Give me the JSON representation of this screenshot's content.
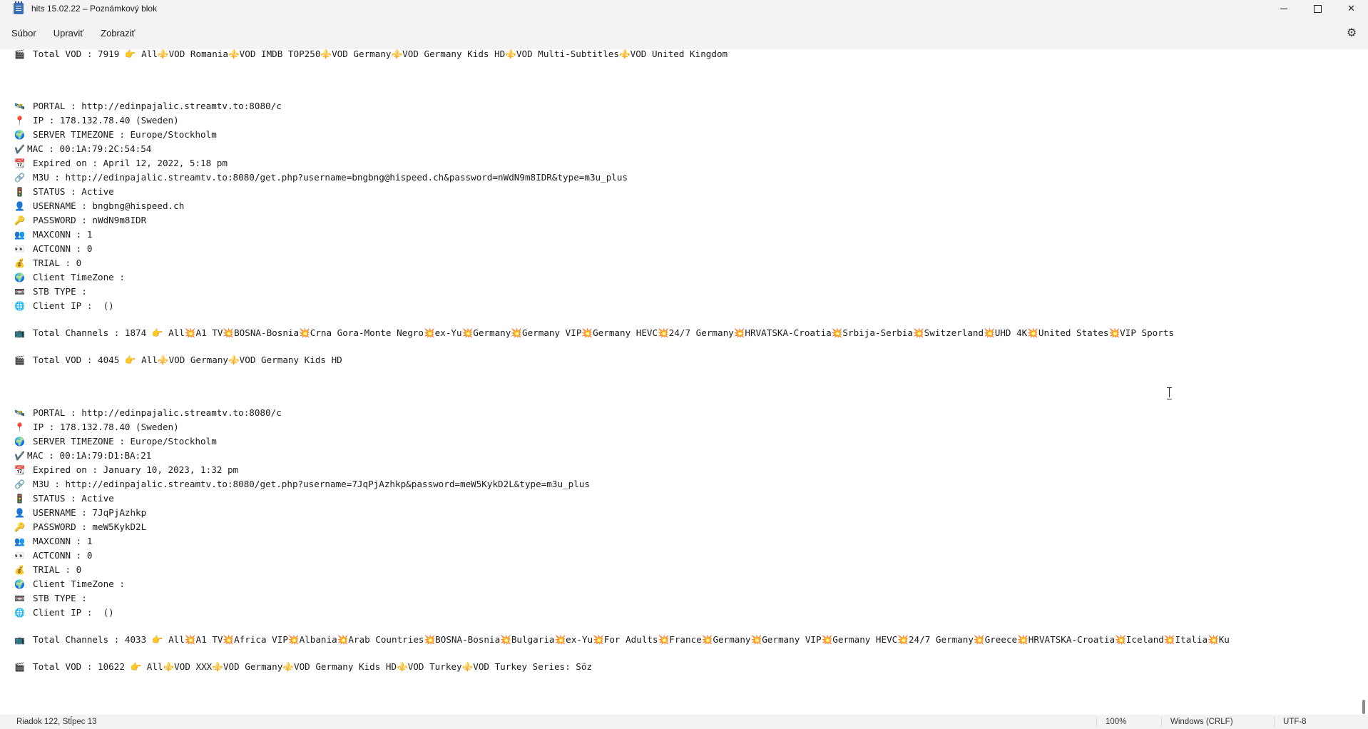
{
  "window": {
    "title": "hits 15.02.22 – Poznámkový blok"
  },
  "menu": {
    "file": "Súbor",
    "edit": "Upraviť",
    "view": "Zobraziť"
  },
  "lines": [
    {
      "emoji": "🎬",
      "text": "Total VOD : 7919 👉 All⚜️VOD Romania⚜️VOD IMDB TOP250⚜️VOD Germany⚜️VOD Germany Kids HD⚜️VOD Multi-Subtitles⚜️VOD United Kingdom"
    },
    {
      "emoji": "🛰️",
      "text": "PORTAL : http://edinpajalic.streamtv.to:8080/c"
    },
    {
      "emoji": "📍",
      "text": "IP : 178.132.78.40 (Sweden)"
    },
    {
      "emoji": "🌍",
      "text": "SERVER TIMEZONE : Europe/Stockholm"
    },
    {
      "emoji": "✔️",
      "text": "MAC : 00:1A:79:2C:54:54"
    },
    {
      "emoji": "📆",
      "text": "Expired on : April 12, 2022, 5:18 pm"
    },
    {
      "emoji": "🔗",
      "text": "M3U : http://edinpajalic.streamtv.to:8080/get.php?username=bngbng@hispeed.ch&password=nWdN9m8IDR&type=m3u_plus"
    },
    {
      "emoji": "🚦",
      "text": "STATUS : Active"
    },
    {
      "emoji": "👤",
      "text": "USERNAME : bngbng@hispeed.ch"
    },
    {
      "emoji": "🔑",
      "text": "PASSWORD : nWdN9m8IDR"
    },
    {
      "emoji": "👥",
      "text": "MAXCONN : 1"
    },
    {
      "emoji": "👀",
      "text": "ACTCONN : 0"
    },
    {
      "emoji": "💰",
      "text": "TRIAL : 0"
    },
    {
      "emoji": "🌍",
      "text": "Client TimeZone :"
    },
    {
      "emoji": "📼",
      "text": "STB TYPE :"
    },
    {
      "emoji": "🌐",
      "text": "Client IP :  ()"
    },
    {
      "emoji": "📺",
      "text": "Total Channels : 1874 👉 All💥A1 TV💥BOSNA-Bosnia💥Crna Gora-Monte Negro💥ex-Yu💥Germany💥Germany VIP💥Germany HEVC💥24/7 Germany💥HRVATSKA-Croatia💥Srbija-Serbia💥Switzerland💥UHD 4K💥United States💥VIP Sports"
    },
    {
      "emoji": "🎬",
      "text": "Total VOD : 4045 👉 All⚜️VOD Germany⚜️VOD Germany Kids HD"
    },
    {
      "emoji": "🛰️",
      "text": "PORTAL : http://edinpajalic.streamtv.to:8080/c"
    },
    {
      "emoji": "📍",
      "text": "IP : 178.132.78.40 (Sweden)"
    },
    {
      "emoji": "🌍",
      "text": "SERVER TIMEZONE : Europe/Stockholm"
    },
    {
      "emoji": "✔️",
      "text": "MAC : 00:1A:79:D1:BA:21"
    },
    {
      "emoji": "📆",
      "text": "Expired on : January 10, 2023, 1:32 pm"
    },
    {
      "emoji": "🔗",
      "text": "M3U : http://edinpajalic.streamtv.to:8080/get.php?username=7JqPjAzhkp&password=meW5KykD2L&type=m3u_plus"
    },
    {
      "emoji": "🚦",
      "text": "STATUS : Active"
    },
    {
      "emoji": "👤",
      "text": "USERNAME : 7JqPjAzhkp"
    },
    {
      "emoji": "🔑",
      "text": "PASSWORD : meW5KykD2L"
    },
    {
      "emoji": "👥",
      "text": "MAXCONN : 1"
    },
    {
      "emoji": "👀",
      "text": "ACTCONN : 0"
    },
    {
      "emoji": "💰",
      "text": "TRIAL : 0"
    },
    {
      "emoji": "🌍",
      "text": "Client TimeZone :"
    },
    {
      "emoji": "📼",
      "text": "STB TYPE :"
    },
    {
      "emoji": "🌐",
      "text": "Client IP :  ()"
    },
    {
      "emoji": "📺",
      "text": "Total Channels : 4033 👉 All💥A1 TV💥Africa VIP💥Albania💥Arab Countries💥BOSNA-Bosnia💥Bulgaria💥ex-Yu💥For Adults💥France💥Germany💥Germany VIP💥Germany HEVC💥24/7 Germany💥Greece💥HRVATSKA-Croatia💥Iceland💥Italia💥Ku"
    },
    {
      "emoji": "🎬",
      "text": "Total VOD : 10622 👉 All⚜️VOD XXX⚜️VOD Germany⚜️VOD Germany Kids HD⚜️VOD Turkey⚜️VOD Turkey Series: Söz"
    }
  ],
  "status": {
    "position": "Riadok 122, Stĺpec 13",
    "zoom": "100%",
    "line_ending": "Windows (CRLF)",
    "encoding": "UTF-8"
  }
}
